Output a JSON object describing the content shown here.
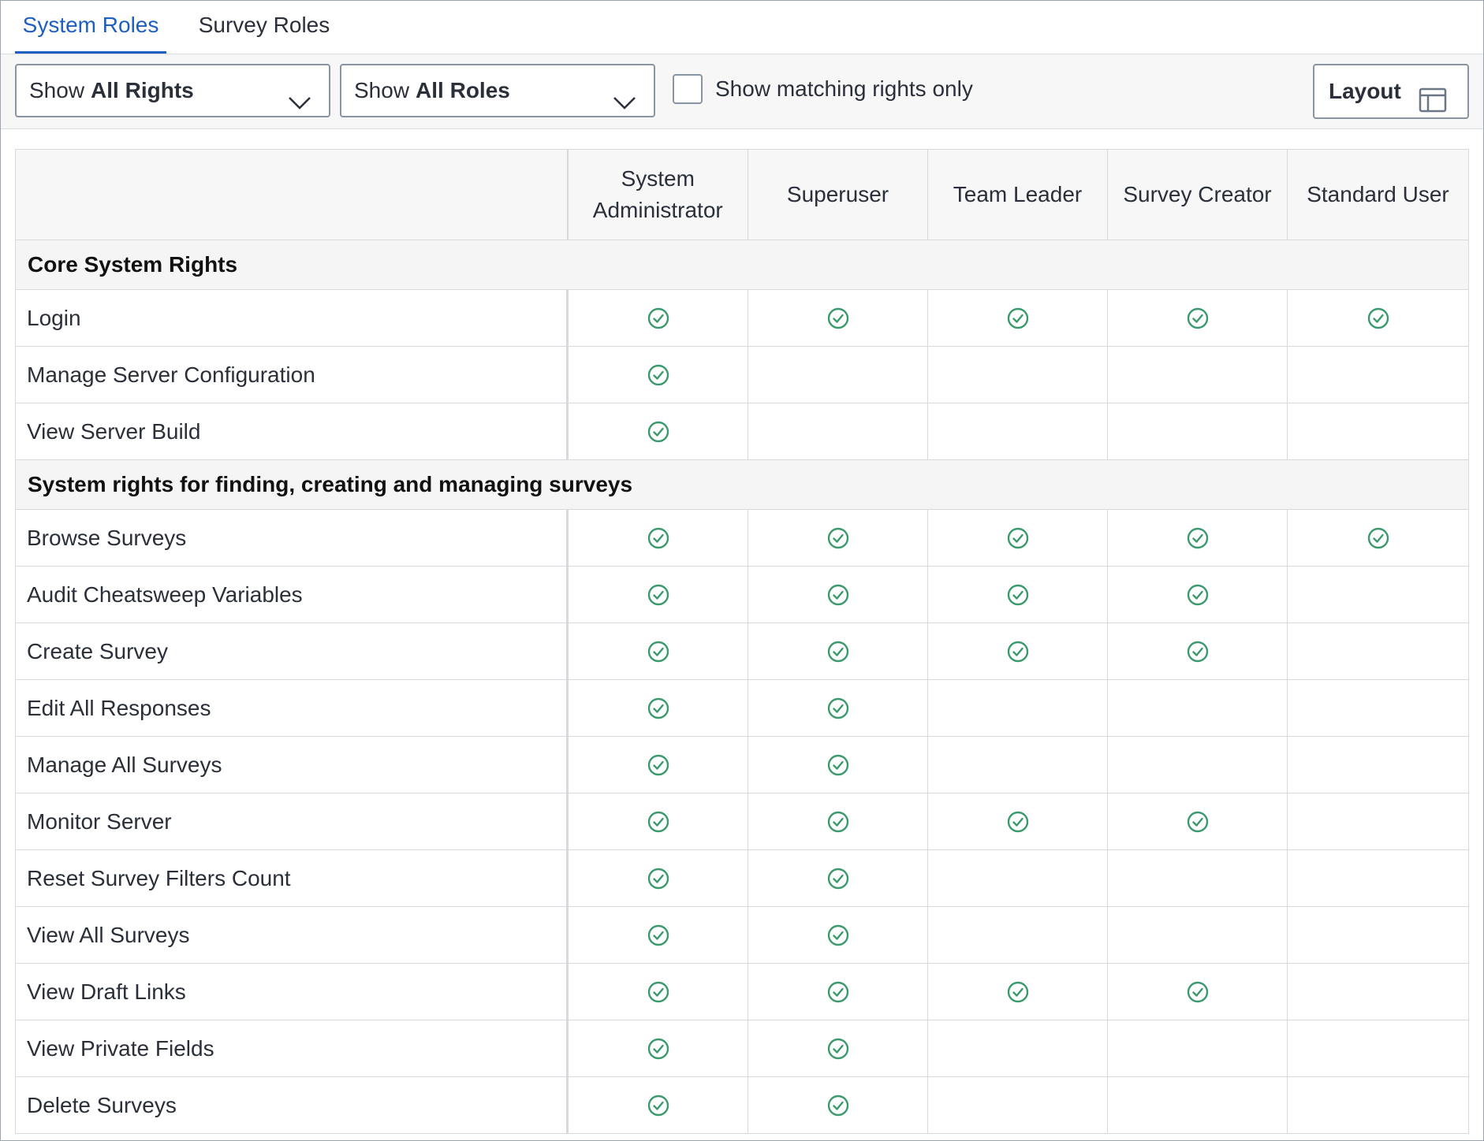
{
  "tabs": [
    {
      "label": "System Roles",
      "active": true
    },
    {
      "label": "Survey Roles",
      "active": false
    }
  ],
  "toolbar": {
    "rights_filter": {
      "prefix": "Show",
      "value": "All Rights"
    },
    "roles_filter": {
      "prefix": "Show",
      "value": "All Roles"
    },
    "matching_checkbox": {
      "label": "Show matching rights only",
      "checked": false
    },
    "layout_button": {
      "label": "Layout",
      "icon": "layout-icon"
    }
  },
  "table": {
    "columns": [
      {
        "id": "sysadmin",
        "line1": "System",
        "line2": "Administrator"
      },
      {
        "id": "superuser",
        "line1": "Superuser",
        "line2": ""
      },
      {
        "id": "teamlead",
        "line1": "Team Leader",
        "line2": ""
      },
      {
        "id": "creator",
        "line1": "Survey Creator",
        "line2": ""
      },
      {
        "id": "standard",
        "line1": "Standard User",
        "line2": ""
      }
    ],
    "check_icon": "check-circle-icon",
    "check_color": "#3a9a6e",
    "sections": [
      {
        "title": "Core System Rights",
        "rows": [
          {
            "name": "Login",
            "grants": [
              true,
              true,
              true,
              true,
              true
            ]
          },
          {
            "name": "Manage Server Configuration",
            "grants": [
              true,
              false,
              false,
              false,
              false
            ]
          },
          {
            "name": "View Server Build",
            "grants": [
              true,
              false,
              false,
              false,
              false
            ]
          }
        ]
      },
      {
        "title": "System rights for finding, creating and managing surveys",
        "rows": [
          {
            "name": "Browse Surveys",
            "grants": [
              true,
              true,
              true,
              true,
              true
            ]
          },
          {
            "name": "Audit Cheatsweep Variables",
            "grants": [
              true,
              true,
              true,
              true,
              false
            ]
          },
          {
            "name": "Create Survey",
            "grants": [
              true,
              true,
              true,
              true,
              false
            ]
          },
          {
            "name": "Edit All Responses",
            "grants": [
              true,
              true,
              false,
              false,
              false
            ]
          },
          {
            "name": "Manage All Surveys",
            "grants": [
              true,
              true,
              false,
              false,
              false
            ]
          },
          {
            "name": "Monitor Server",
            "grants": [
              true,
              true,
              true,
              true,
              false
            ]
          },
          {
            "name": "Reset Survey Filters Count",
            "grants": [
              true,
              true,
              false,
              false,
              false
            ]
          },
          {
            "name": "View All Surveys",
            "grants": [
              true,
              true,
              false,
              false,
              false
            ]
          },
          {
            "name": "View Draft Links",
            "grants": [
              true,
              true,
              true,
              true,
              false
            ]
          },
          {
            "name": "View Private Fields",
            "grants": [
              true,
              true,
              false,
              false,
              false
            ]
          },
          {
            "name": "Delete Surveys",
            "grants": [
              true,
              true,
              false,
              false,
              false
            ]
          }
        ]
      }
    ]
  }
}
